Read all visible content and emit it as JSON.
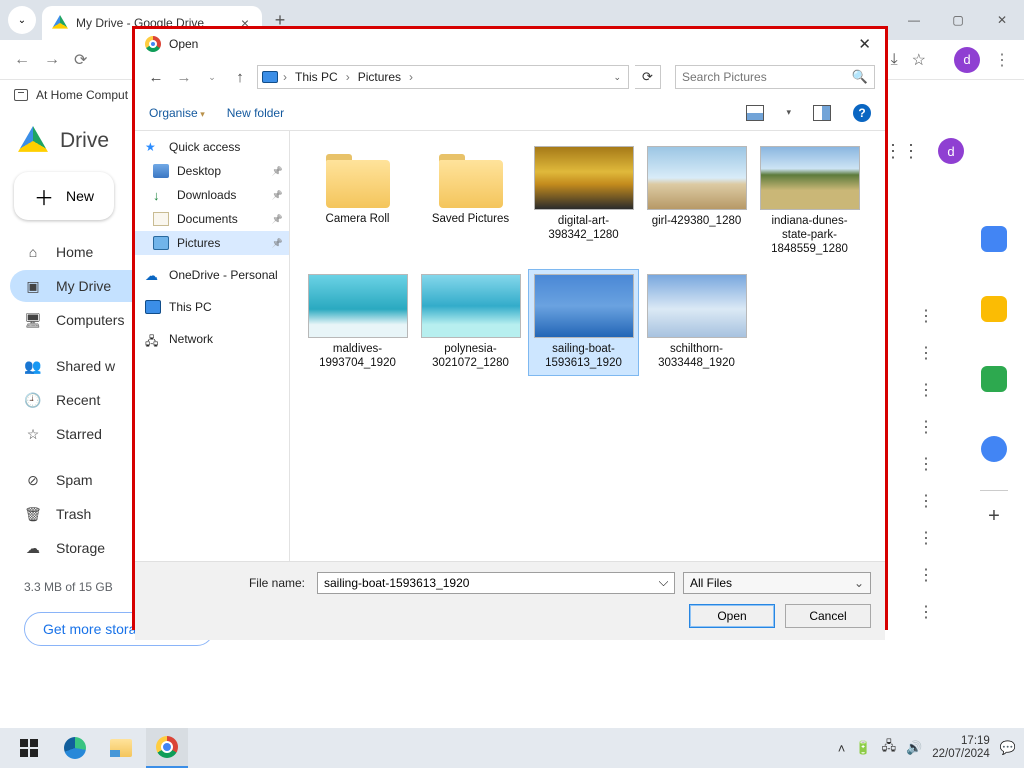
{
  "chrome": {
    "tab_title": "My Drive - Google Drive",
    "bookmark": "At Home Comput",
    "avatar_initial": "d"
  },
  "drive": {
    "brand": "Drive",
    "new_btn": "New",
    "nav": {
      "home": "Home",
      "my_drive": "My Drive",
      "computers": "Computers",
      "shared": "Shared w",
      "recent": "Recent",
      "starred": "Starred",
      "spam": "Spam",
      "trash": "Trash",
      "storage": "Storage"
    },
    "storage_text": "3.3 MB of 15 GB",
    "get_storage": "Get more storage"
  },
  "dialog": {
    "title": "Open",
    "breadcrumb": {
      "root": "This PC",
      "folder": "Pictures"
    },
    "search_placeholder": "Search Pictures",
    "toolbar": {
      "organise": "Organise",
      "new_folder": "New folder"
    },
    "nav": {
      "quick": "Quick access",
      "desktop": "Desktop",
      "downloads": "Downloads",
      "documents": "Documents",
      "pictures": "Pictures",
      "onedrive": "OneDrive - Personal",
      "this_pc": "This PC",
      "network": "Network"
    },
    "files": [
      {
        "name": "Camera Roll",
        "type": "folder"
      },
      {
        "name": "Saved Pictures",
        "type": "folder"
      },
      {
        "name": "digital-art-398342_1280",
        "type": "image",
        "thumb": "sunset"
      },
      {
        "name": "girl-429380_1280",
        "type": "image",
        "thumb": "beach"
      },
      {
        "name": "indiana-dunes-state-park-1848559_1280",
        "type": "image",
        "thumb": "dunes"
      },
      {
        "name": "maldives-1993704_1920",
        "type": "image",
        "thumb": "teal"
      },
      {
        "name": "polynesia-3021072_1280",
        "type": "image",
        "thumb": "lagoon"
      },
      {
        "name": "sailing-boat-1593613_1920",
        "type": "image",
        "thumb": "sail",
        "selected": true
      },
      {
        "name": "schilthorn-3033448_1920",
        "type": "image",
        "thumb": "snow"
      }
    ],
    "file_name_label": "File name:",
    "file_name_value": "sailing-boat-1593613_1920",
    "file_type": "All Files",
    "open_btn": "Open",
    "cancel_btn": "Cancel"
  },
  "taskbar": {
    "time": "17:19",
    "date": "22/07/2024"
  }
}
